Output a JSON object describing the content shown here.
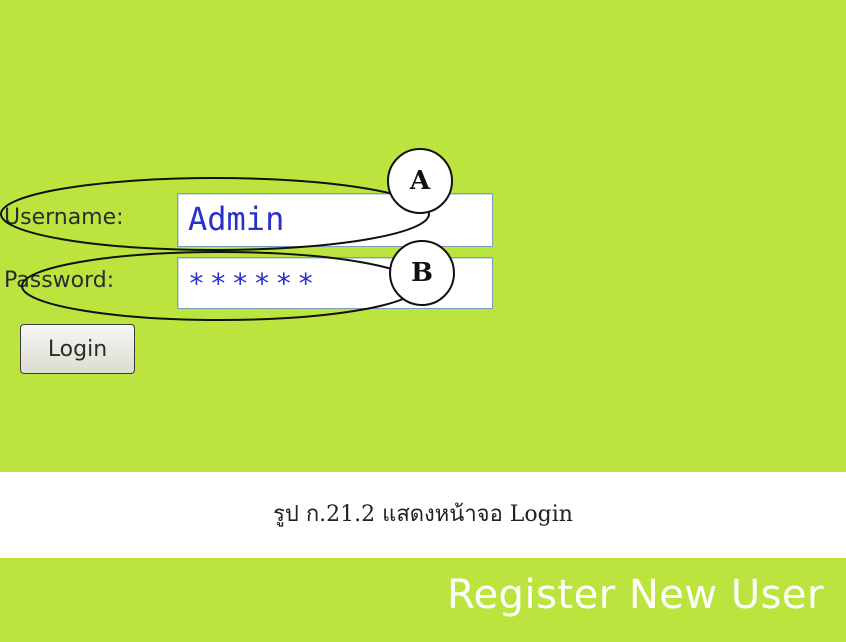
{
  "form": {
    "username_label": "Username:",
    "username_value": "Admin",
    "password_label": "Password:",
    "password_value": "******",
    "login_label": "Login"
  },
  "annotations": {
    "a": "A",
    "b": "B"
  },
  "caption": "รูป ก.21.2 แสดงหน้าจอ Login",
  "register_link": "Register New User",
  "colors": {
    "panel_green": "#bbe53e",
    "input_text": "#2a30c9",
    "register_text": "#ffffff"
  }
}
